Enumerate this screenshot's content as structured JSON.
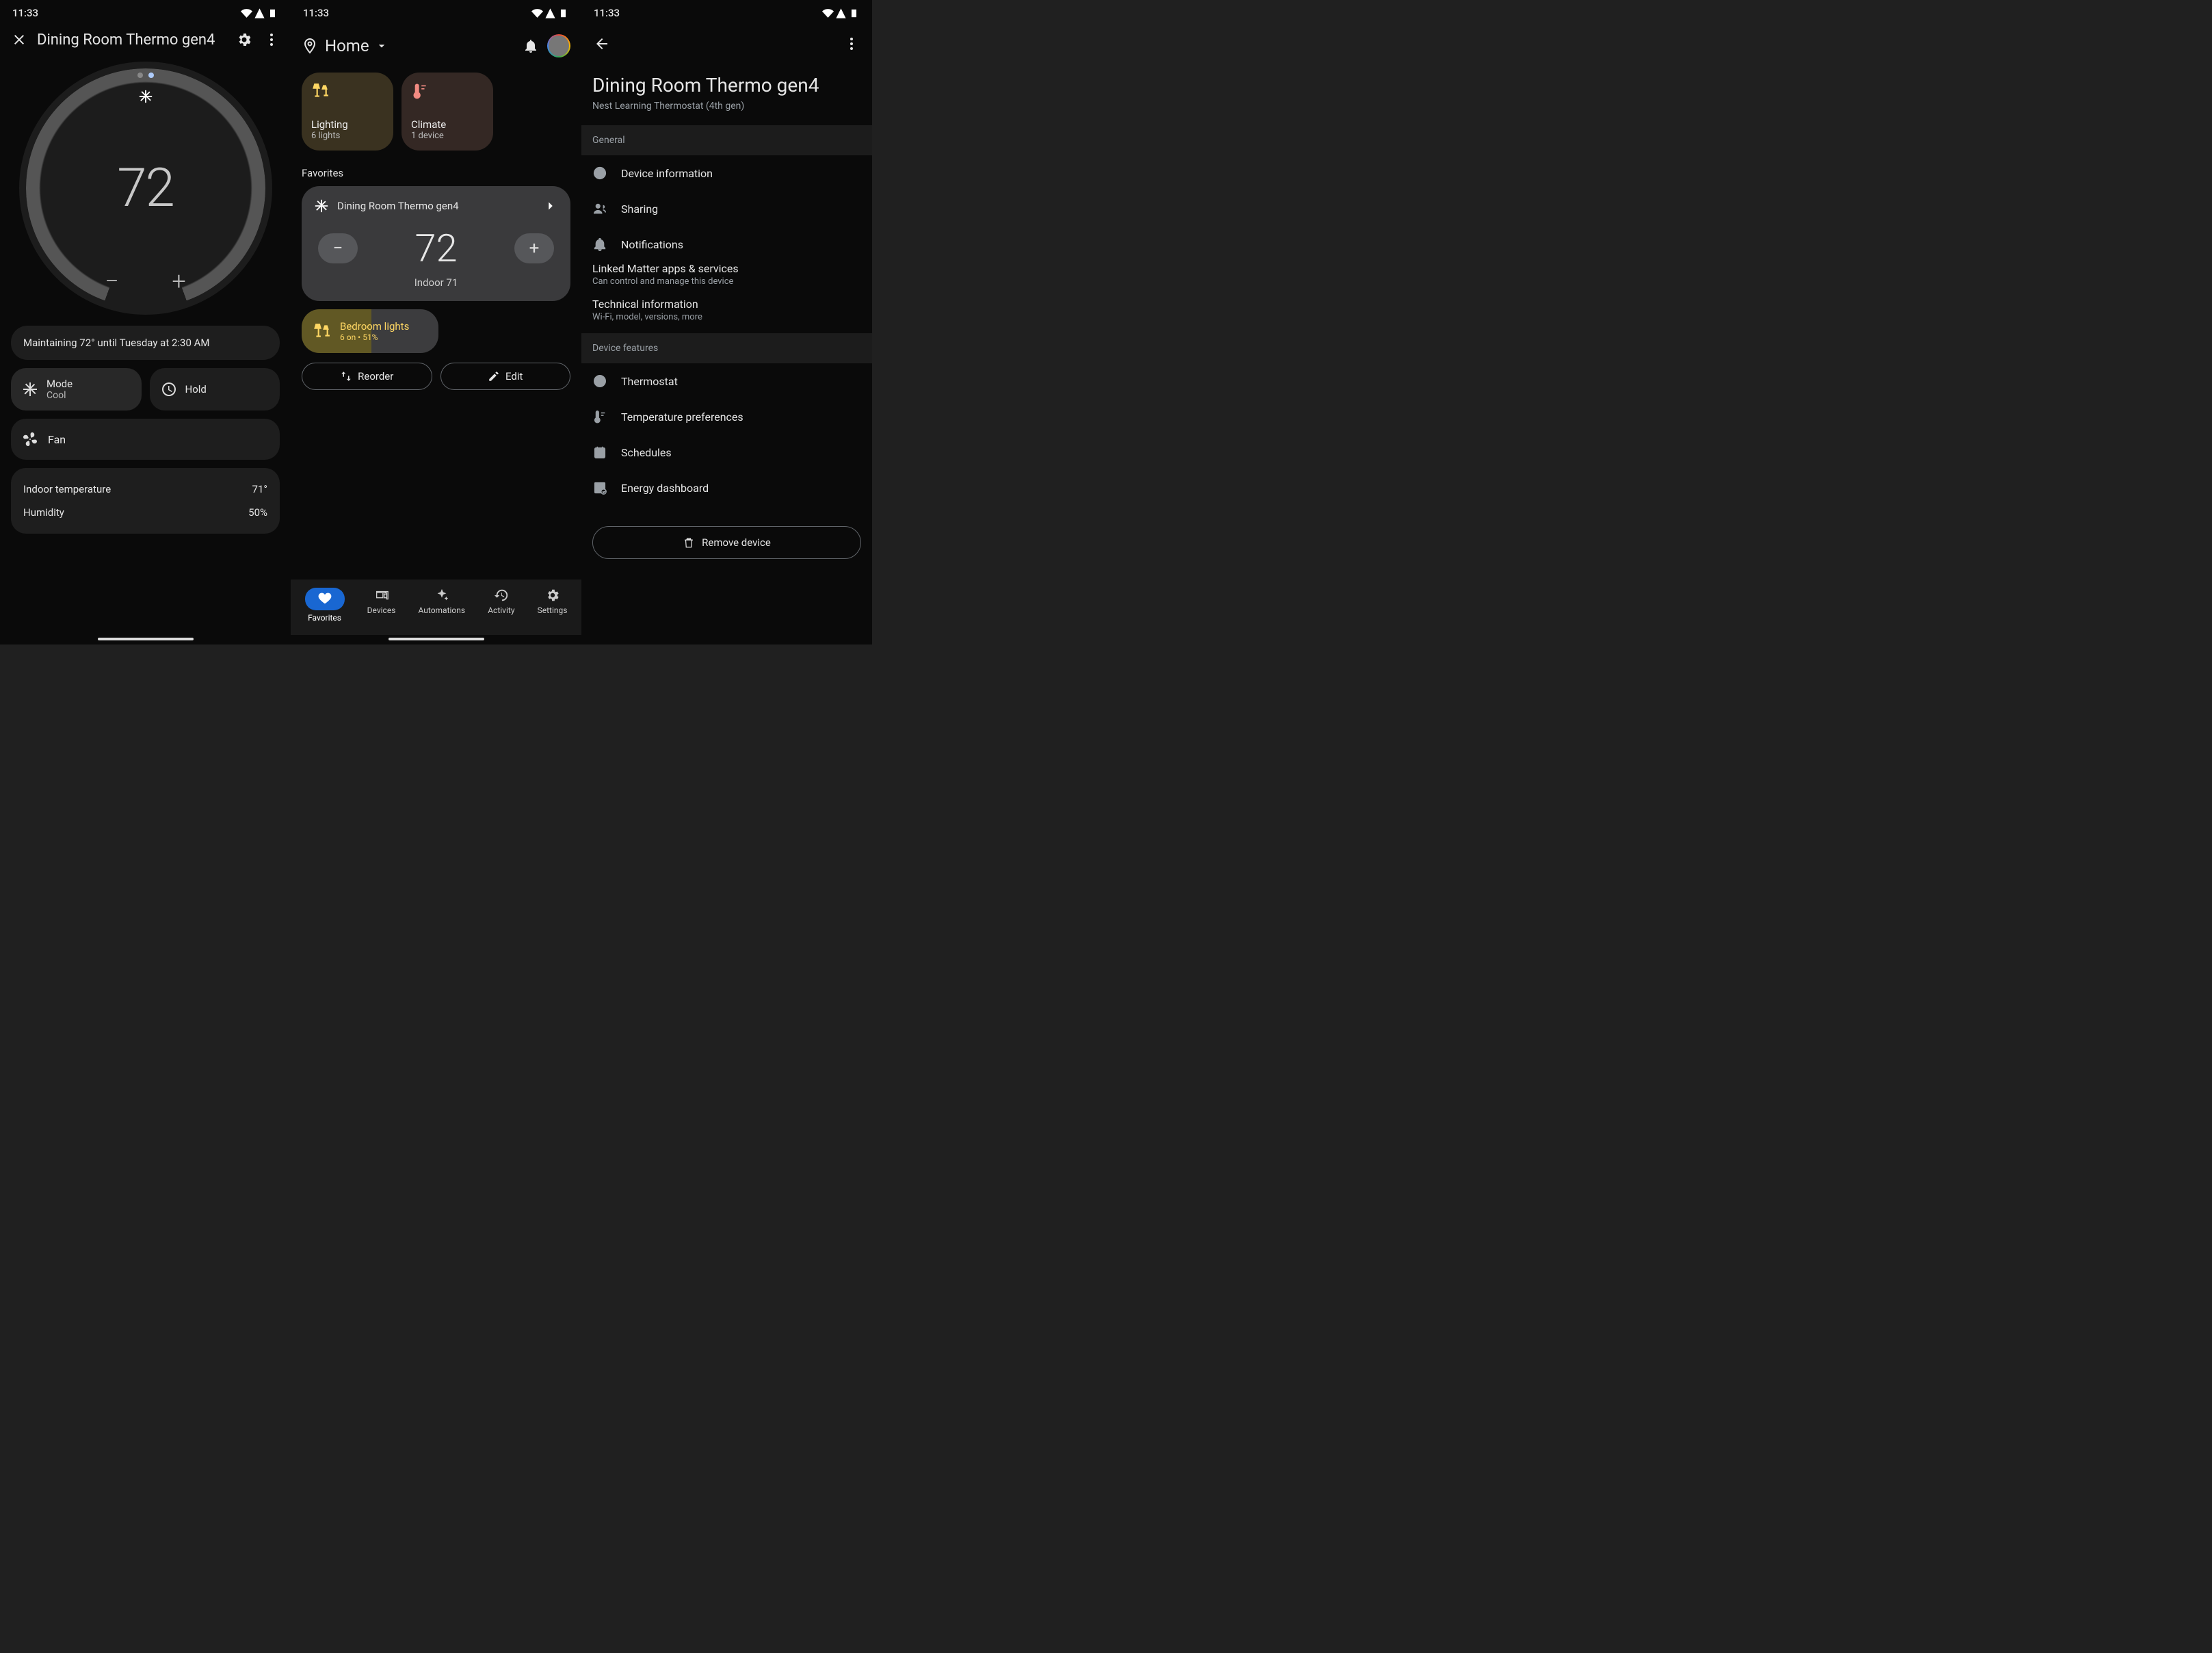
{
  "status": {
    "time": "11:33"
  },
  "s1": {
    "title": "Dining Room Thermo gen4",
    "temp": "72",
    "maintain": "Maintaining 72° until Tuesday at 2:30 AM",
    "mode_label": "Mode",
    "mode_value": "Cool",
    "hold": "Hold",
    "fan": "Fan",
    "indoor_label": "Indoor temperature",
    "indoor_value": "71°",
    "humidity_label": "Humidity",
    "humidity_value": "50%"
  },
  "s2": {
    "home": "Home",
    "lighting_t": "Lighting",
    "lighting_s": "6 lights",
    "climate_t": "Climate",
    "climate_s": "1 device",
    "favorites": "Favorites",
    "thermo_name": "Dining Room Thermo gen4",
    "thermo_temp": "72",
    "indoor": "Indoor 71",
    "lights_t": "Bedroom lights",
    "lights_s": "6 on • 51%",
    "reorder": "Reorder",
    "edit": "Edit",
    "tabs": {
      "fav": "Favorites",
      "dev": "Devices",
      "auto": "Automations",
      "act": "Activity",
      "set": "Settings"
    }
  },
  "s3": {
    "title": "Dining Room Thermo gen4",
    "sub": "Nest Learning Thermostat (4th gen)",
    "general": "General",
    "dev_info": "Device information",
    "sharing": "Sharing",
    "notif": "Notifications",
    "matter_t": "Linked Matter apps & services",
    "matter_s": "Can control and manage this device",
    "tech_t": "Technical information",
    "tech_s": "Wi-Fi, model, versions, more",
    "features": "Device features",
    "thermostat": "Thermostat",
    "temp_pref": "Temperature preferences",
    "schedules": "Schedules",
    "energy": "Energy dashboard",
    "remove": "Remove device"
  }
}
